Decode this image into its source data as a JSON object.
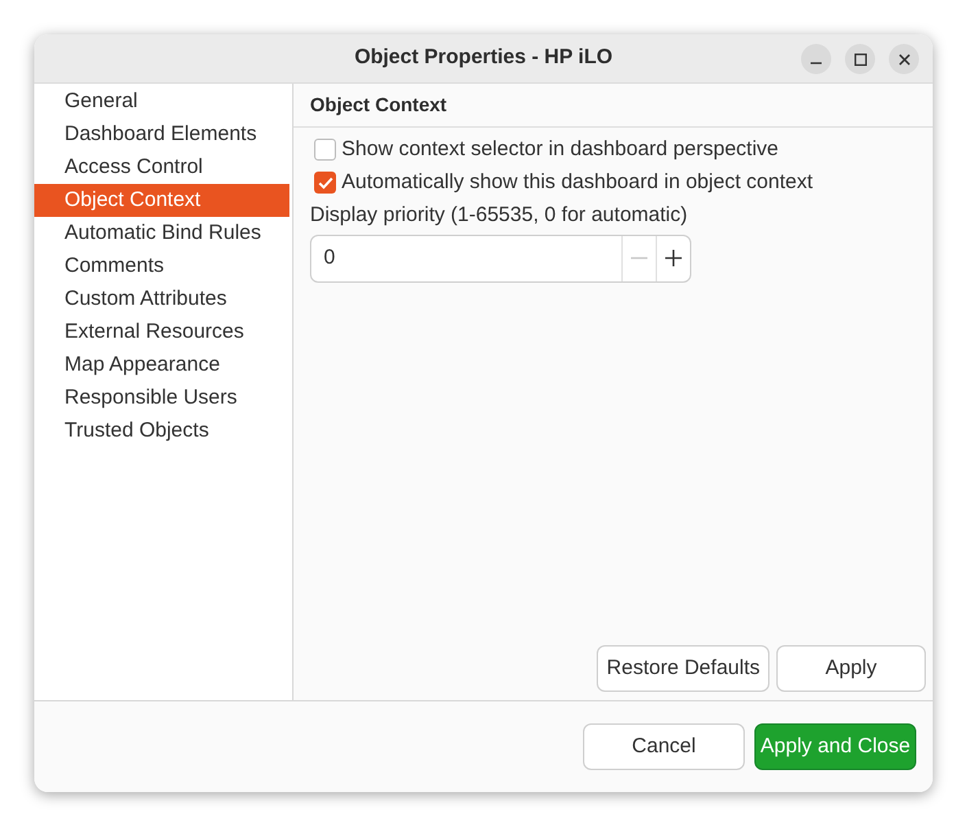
{
  "window": {
    "title": "Object Properties - HP iLO"
  },
  "sidebar": {
    "items": [
      {
        "label": "General",
        "selected": false
      },
      {
        "label": "Dashboard Elements",
        "selected": false
      },
      {
        "label": "Access Control",
        "selected": false
      },
      {
        "label": "Object Context",
        "selected": true
      },
      {
        "label": "Automatic Bind Rules",
        "selected": false
      },
      {
        "label": "Comments",
        "selected": false
      },
      {
        "label": "Custom Attributes",
        "selected": false
      },
      {
        "label": "External Resources",
        "selected": false
      },
      {
        "label": "Map Appearance",
        "selected": false
      },
      {
        "label": "Responsible Users",
        "selected": false
      },
      {
        "label": "Trusted Objects",
        "selected": false
      }
    ]
  },
  "page": {
    "title": "Object Context",
    "checkboxes": [
      {
        "label": "Show context selector in dashboard perspective",
        "checked": false
      },
      {
        "label": "Automatically show this dashboard in object context",
        "checked": true
      }
    ],
    "priority": {
      "label": "Display priority (1-65535, 0 for automatic)",
      "value": "0",
      "decrement_disabled": true,
      "increment_disabled": false
    },
    "buttons": [
      "Restore Defaults",
      "Apply"
    ]
  },
  "footer": {
    "buttons": [
      {
        "label": "Cancel",
        "kind": "normal"
      },
      {
        "label": "Apply and Close",
        "kind": "primary"
      }
    ]
  }
}
